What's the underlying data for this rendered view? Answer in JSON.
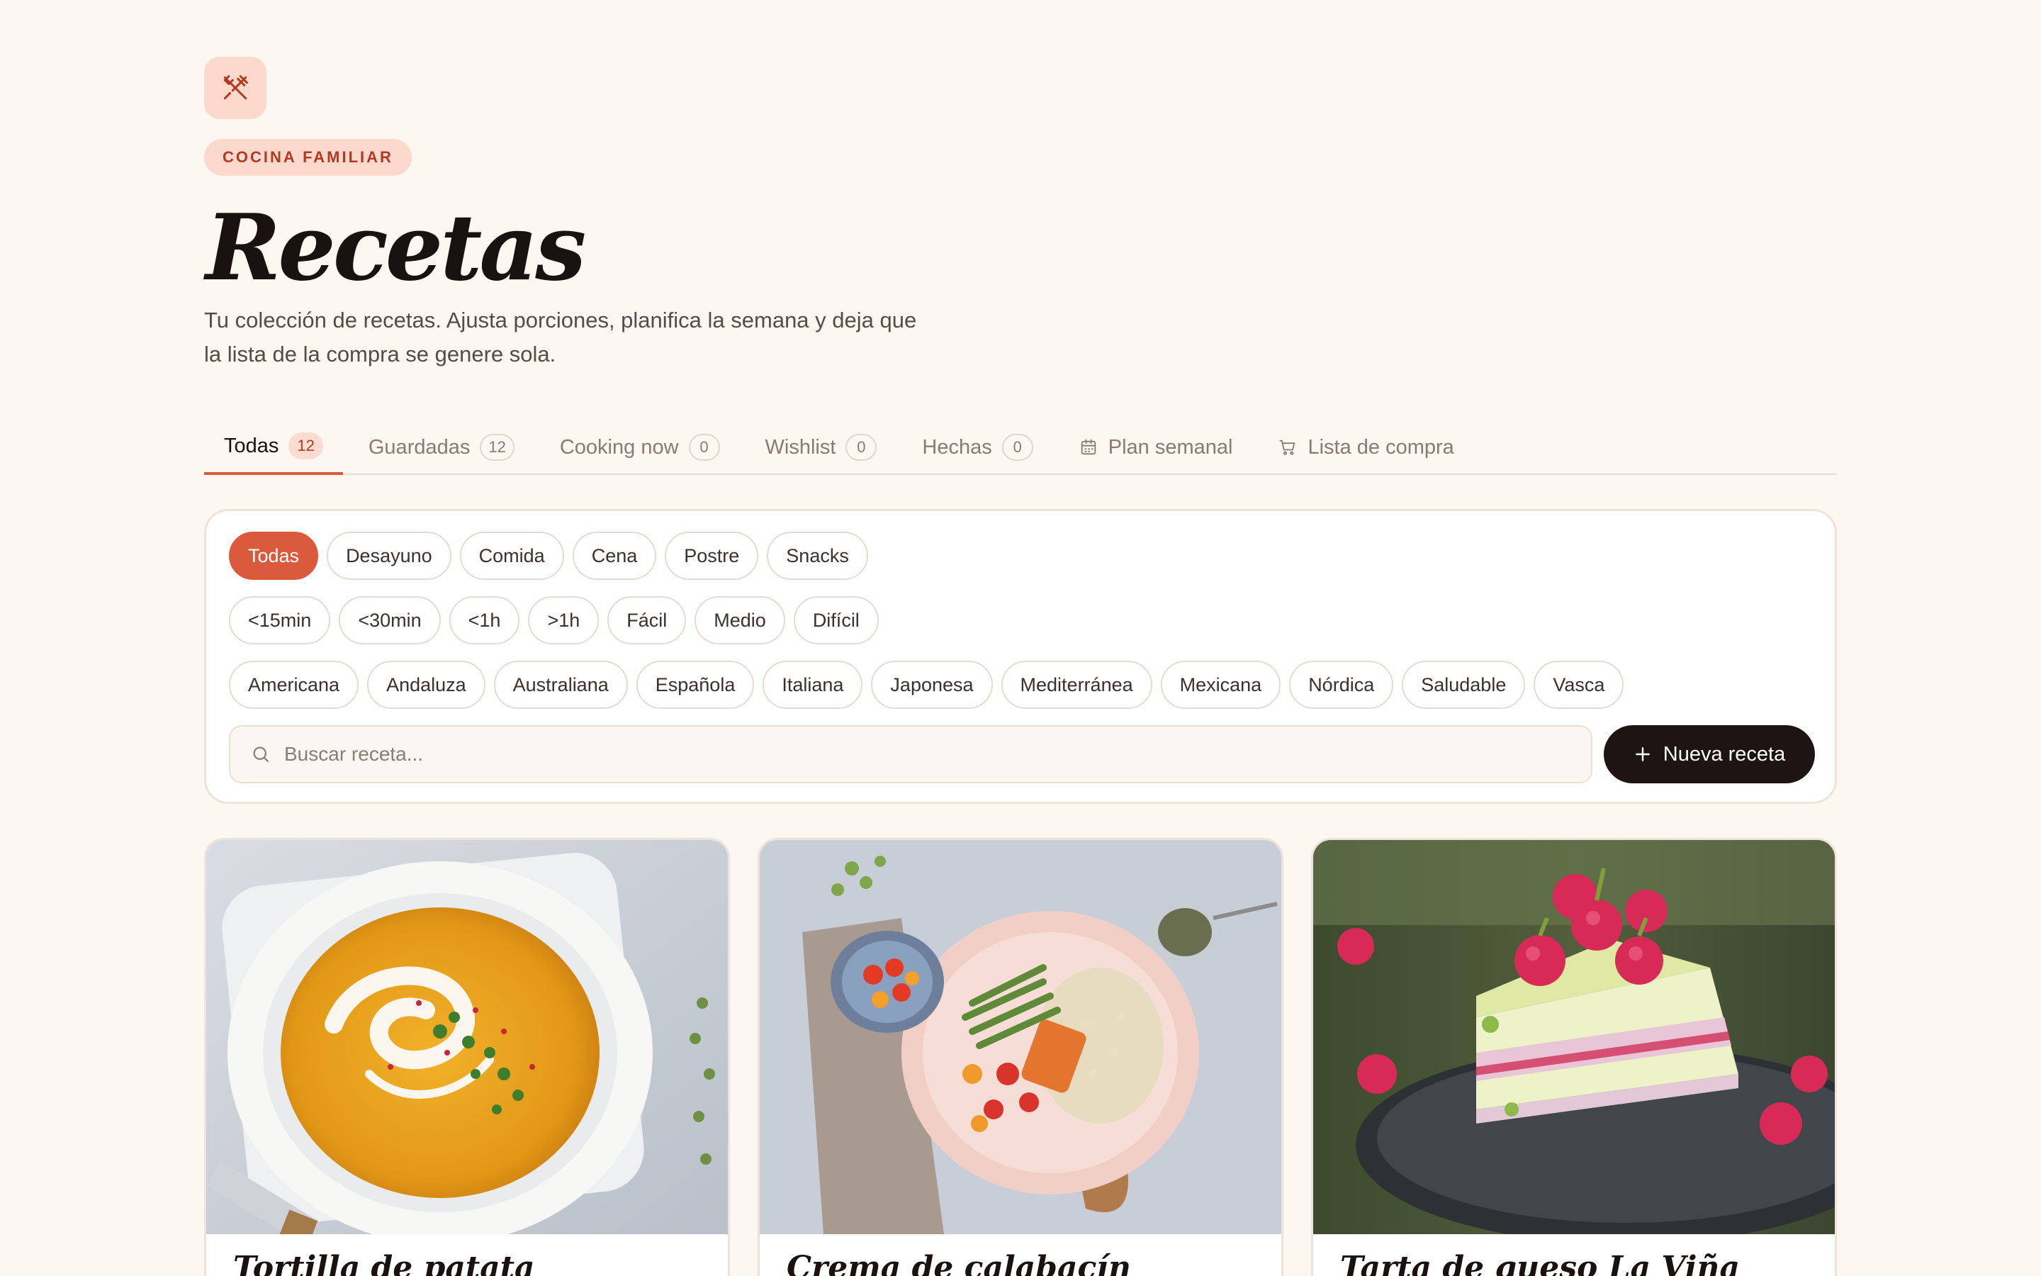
{
  "header": {
    "eyebrow": "COCINA FAMILIAR",
    "title": "Recetas",
    "subtitle_line1": "Tu colección de recetas. Ajusta porciones, planifica la semana y deja que",
    "subtitle_line2": "la lista de la compra se genere sola."
  },
  "tabs": [
    {
      "label": "Todas",
      "count": "12",
      "active": true
    },
    {
      "label": "Guardadas",
      "count": "12"
    },
    {
      "label": "Cooking now",
      "count": "0"
    },
    {
      "label": "Wishlist",
      "count": "0"
    },
    {
      "label": "Hechas",
      "count": "0"
    },
    {
      "label": "Plan semanal",
      "icon": "calendar-icon"
    },
    {
      "label": "Lista de compra",
      "icon": "cart-icon"
    }
  ],
  "filters": {
    "meal": [
      "Todas",
      "Desayuno",
      "Comida",
      "Cena",
      "Postre",
      "Snacks"
    ],
    "meal_active": "Todas",
    "time_difficulty": [
      "<15min",
      "<30min",
      "<1h",
      ">1h",
      "Fácil",
      "Medio",
      "Difícil"
    ],
    "cuisine": [
      "Americana",
      "Andaluza",
      "Australiana",
      "Española",
      "Italiana",
      "Japonesa",
      "Mediterránea",
      "Mexicana",
      "Nórdica",
      "Saludable",
      "Vasca"
    ],
    "search_placeholder": "Buscar receta...",
    "new_recipe_label": "Nueva receta"
  },
  "recipes": [
    {
      "title": "Tortilla de patata",
      "image": "bowl of orange soup with cream swirl and herbs"
    },
    {
      "title": "Crema de calabacín",
      "image": "plate with green beans, couscous and vegetables"
    },
    {
      "title": "Tarta de queso La Viña",
      "image": "layered cake slice topped with raspberries"
    }
  ],
  "colors": {
    "background": "#fdf7f1",
    "accent": "#d95a3c",
    "accent_soft": "#fcd9cc",
    "dark": "#1e1512"
  }
}
